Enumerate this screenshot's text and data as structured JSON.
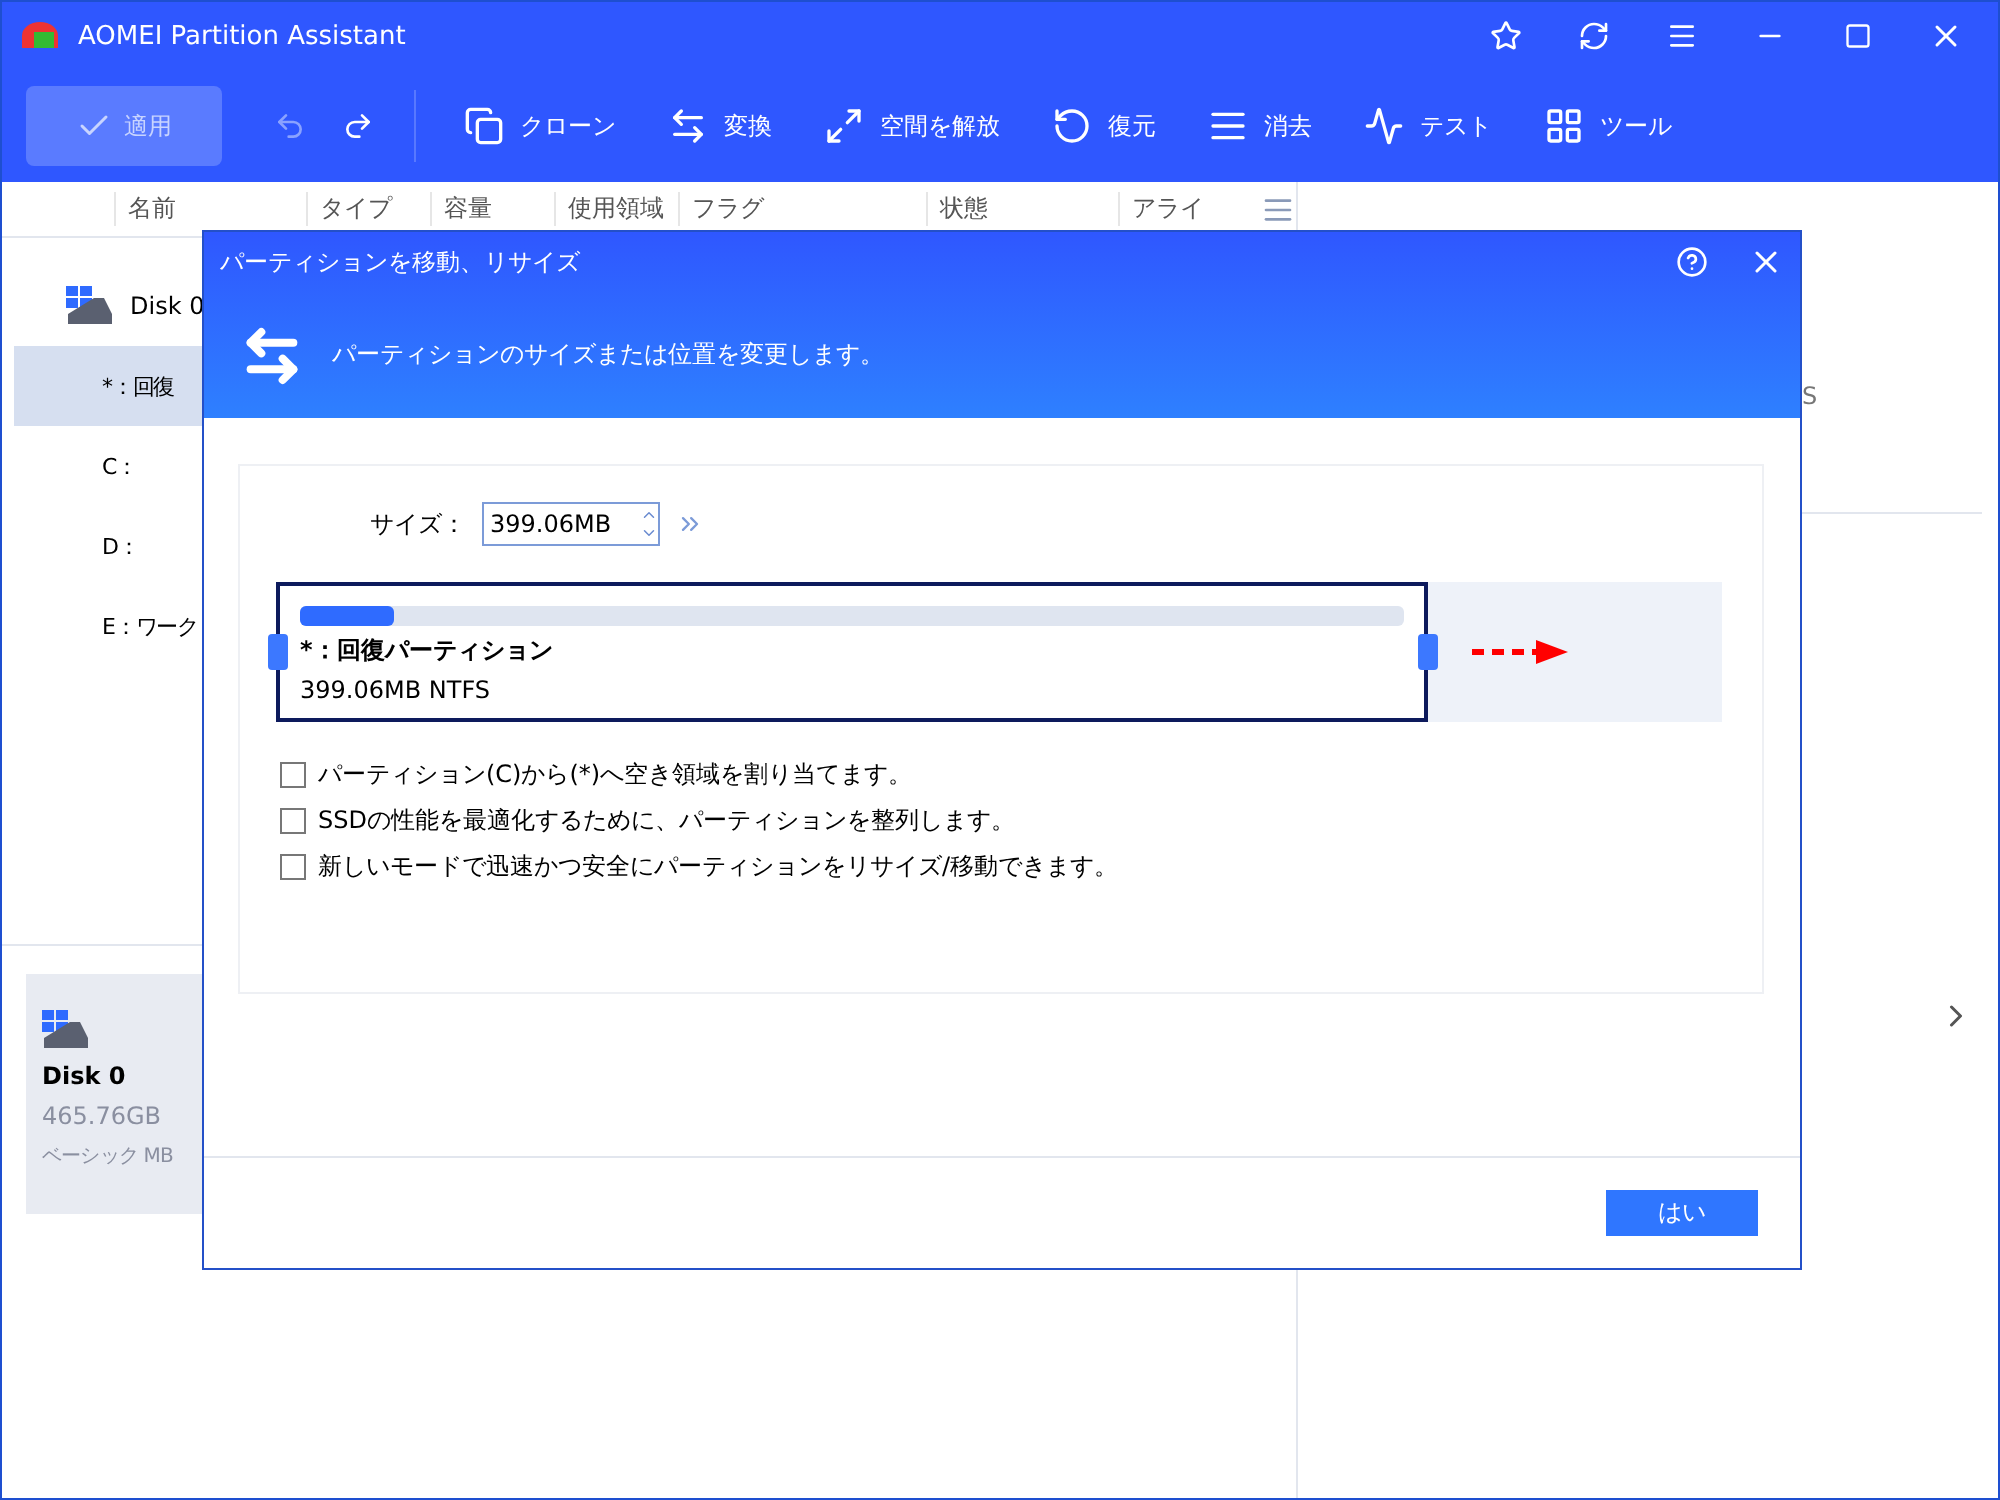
{
  "window": {
    "title": "AOMEI Partition Assistant"
  },
  "toolbar": {
    "apply": {
      "label": "適用",
      "disabled": true
    },
    "undo": {
      "disabled": true
    },
    "redo": {
      "disabled": false
    },
    "tools": [
      {
        "kind": "clone",
        "label": "クローン"
      },
      {
        "kind": "convert",
        "label": "変換"
      },
      {
        "kind": "free",
        "label": "空間を解放"
      },
      {
        "kind": "recover",
        "label": "復元"
      },
      {
        "kind": "wipe",
        "label": "消去"
      },
      {
        "kind": "test",
        "label": "テスト"
      },
      {
        "kind": "tools",
        "label": "ツール"
      }
    ]
  },
  "table": {
    "columns": [
      "名前",
      "タイプ",
      "容量",
      "使用領域",
      "フラグ",
      "状態",
      "アライ"
    ],
    "rows": [
      {
        "kind": "disk",
        "name": "Disk 0",
        "selected": false
      },
      {
        "kind": "partition",
        "name": "*：回復",
        "selected": true
      },
      {
        "kind": "partition",
        "name": "C：",
        "selected": false
      },
      {
        "kind": "partition",
        "name": "D：",
        "selected": false
      },
      {
        "kind": "partition",
        "name": "E：ワーク",
        "selected": false
      }
    ]
  },
  "disk_card": {
    "name": "Disk 0",
    "size": "465.76GB",
    "type": "ベーシック MB"
  },
  "right_panel": {
    "fragment": "S"
  },
  "dialog": {
    "title": "パーティションを移動、リサイズ",
    "subtitle": "パーティションのサイズまたは位置を変更します。",
    "size_label": "サイズ：",
    "size_value": "399.06MB",
    "partition": {
      "name": "*：回復パーティション",
      "info": "399.06MB NTFS",
      "level": 0.085
    },
    "options": [
      {
        "label": "パーティション(C)から(*)へ空き領域を割り当てます。",
        "checked": false
      },
      {
        "label": "SSDの性能を最適化するために、パーティションを整列します。",
        "checked": false
      },
      {
        "label": "新しいモードで迅速かつ安全にパーティションをリサイズ/移動できます。",
        "checked": false
      }
    ],
    "ok": "はい"
  }
}
